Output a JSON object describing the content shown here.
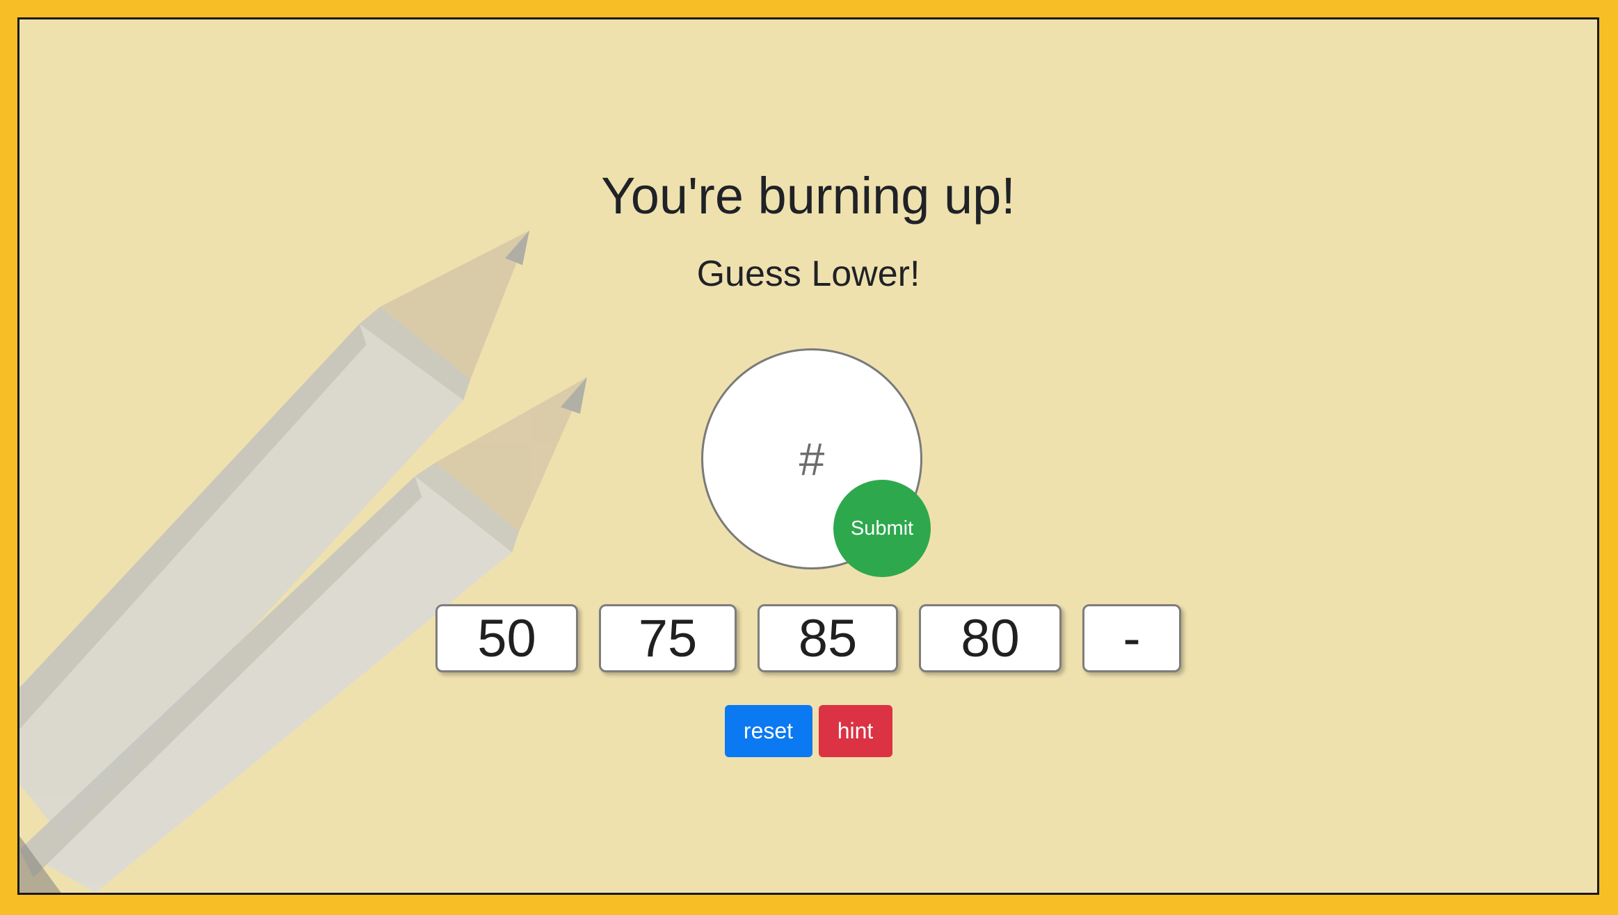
{
  "heading": {
    "title": "You're burning up!",
    "subtitle": "Guess Lower!"
  },
  "guess_form": {
    "placeholder": "#",
    "value": "",
    "submit_label": "Submit"
  },
  "past_guesses": [
    "50",
    "75",
    "85",
    "80",
    "-"
  ],
  "buttons": {
    "reset_label": "reset",
    "hint_label": "hint"
  },
  "colors": {
    "page_border": "#f8be25",
    "background": "#efe1ae",
    "submit": "#2ea84d",
    "reset": "#0b79f2",
    "hint": "#db3344"
  }
}
